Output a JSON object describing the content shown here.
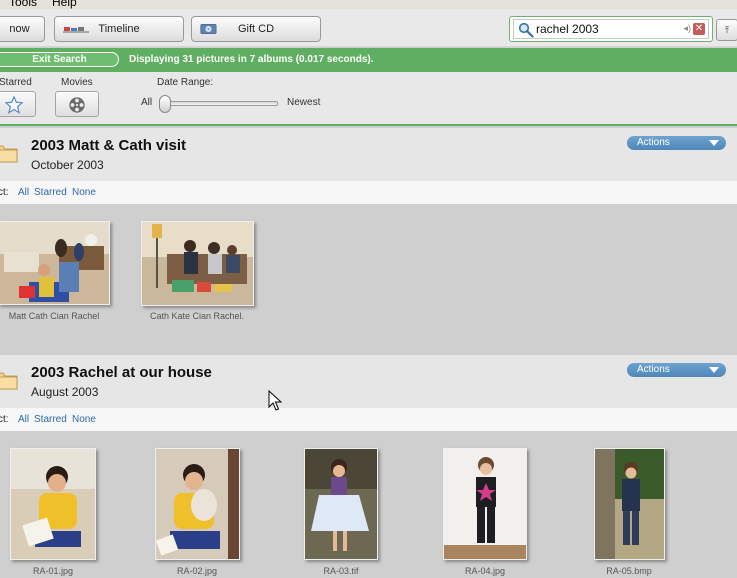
{
  "menubar": {
    "tools": "Tools",
    "help": "Help"
  },
  "toolbar": {
    "partial_button": "now",
    "timeline_label": "Timeline",
    "giftcd_label": "Gift CD"
  },
  "search": {
    "query": "rachel 2003"
  },
  "status": {
    "exit_label": "Exit Search",
    "message": "Displaying 31 pictures in 7 albums (0.017 seconds)."
  },
  "filters": {
    "starred_label": "Starred",
    "movies_label": "Movies",
    "date_range_label": "Date Range:",
    "all_label": "All",
    "newest_label": "Newest"
  },
  "albums": [
    {
      "title": "2003 Matt & Cath visit",
      "date": "October 2003",
      "actions_label": "Actions",
      "select": {
        "prefix": "ct:",
        "all": "All",
        "starred": "Starred",
        "none": "None"
      },
      "photos": [
        {
          "caption": "Matt Cath Cian Rachel"
        },
        {
          "caption": "Cath Kate Cian Rachel."
        }
      ]
    },
    {
      "title": "2003 Rachel at our house",
      "date": "August 2003",
      "actions_label": "Actions",
      "select": {
        "prefix": "ct:",
        "all": "All",
        "starred": "Starred",
        "none": "None"
      },
      "photos": [
        {
          "caption": "RA-01.jpg"
        },
        {
          "caption": "RA-02.jpg"
        },
        {
          "caption": "RA-03.tif"
        },
        {
          "caption": "RA-04.jpg"
        },
        {
          "caption": "RA-05.bmp"
        }
      ]
    }
  ],
  "colors": {
    "accent_green": "#5fae62",
    "actions_blue": "#4f86b8",
    "link_blue": "#2d6aa8"
  }
}
